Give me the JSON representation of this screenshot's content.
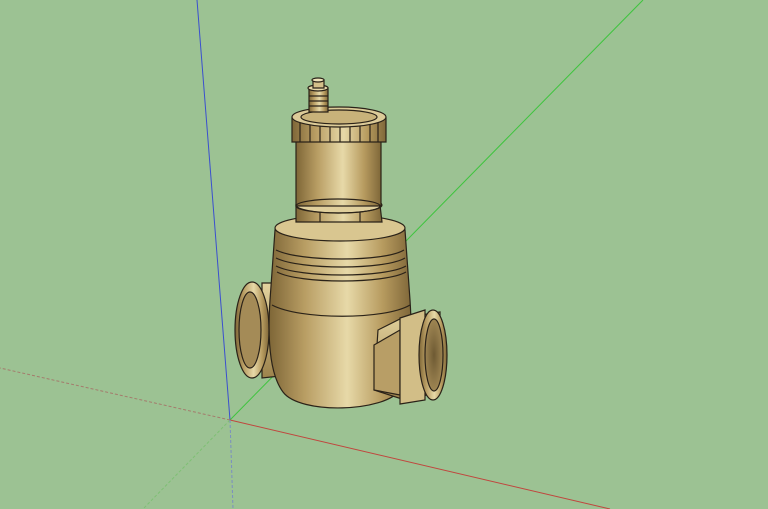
{
  "viewport": {
    "background_color": "#9cc293",
    "axes": {
      "red_color": "#c0463e",
      "green_color": "#3ec43e",
      "blue_color": "#3a4fcf"
    },
    "model": {
      "name": "brass-valve",
      "primary_color": "#c9b27a",
      "highlight_color": "#e9dcae",
      "shadow_color": "#8a6f3e",
      "outline_color": "#2a2218"
    }
  }
}
